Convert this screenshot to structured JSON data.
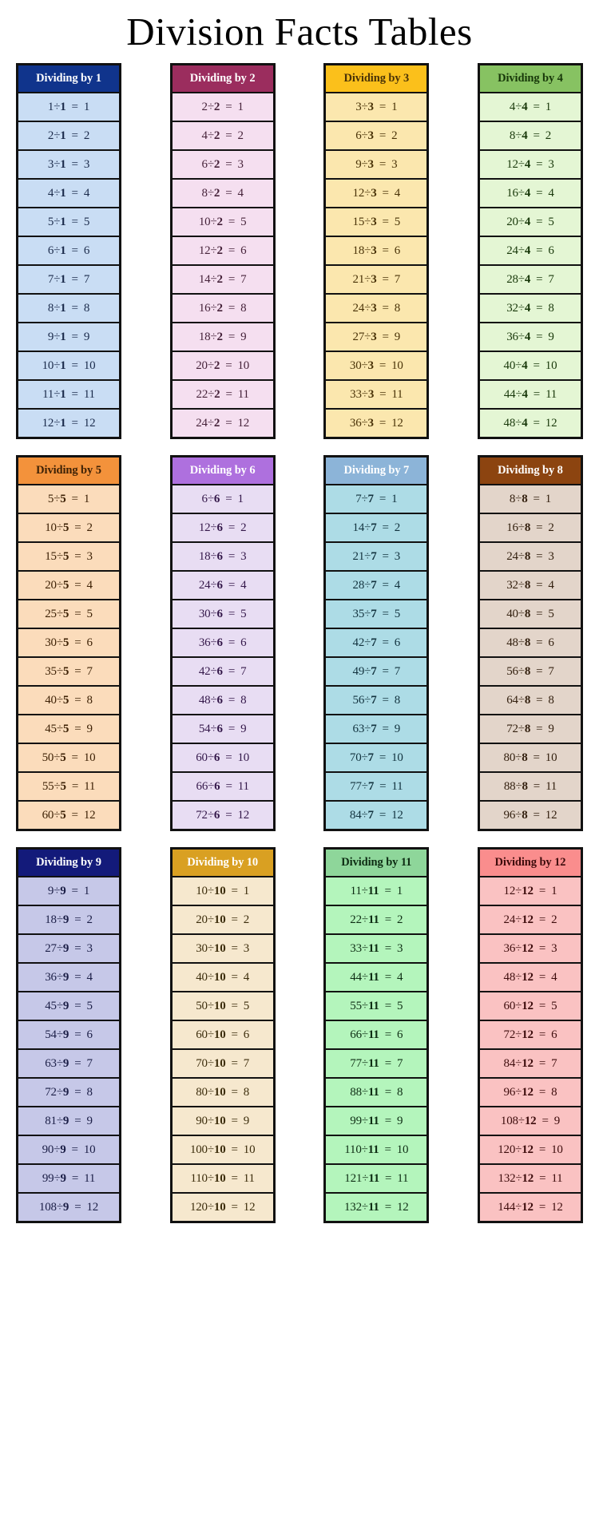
{
  "page": {
    "title": "Division Facts Tables"
  },
  "tables": [
    {
      "id": "dividing-by-1",
      "header": "Dividing by 1",
      "divisor": 1,
      "header_bg": "#10348C",
      "header_fg": "#FFFFFF",
      "cell_bg": "#C9DDF4",
      "cell_fg": "#1B2B4B",
      "rows": [
        {
          "dividend": 1,
          "divisor": 1,
          "quotient": 1
        },
        {
          "dividend": 2,
          "divisor": 1,
          "quotient": 2
        },
        {
          "dividend": 3,
          "divisor": 1,
          "quotient": 3
        },
        {
          "dividend": 4,
          "divisor": 1,
          "quotient": 4
        },
        {
          "dividend": 5,
          "divisor": 1,
          "quotient": 5
        },
        {
          "dividend": 6,
          "divisor": 1,
          "quotient": 6
        },
        {
          "dividend": 7,
          "divisor": 1,
          "quotient": 7
        },
        {
          "dividend": 8,
          "divisor": 1,
          "quotient": 8
        },
        {
          "dividend": 9,
          "divisor": 1,
          "quotient": 9
        },
        {
          "dividend": 10,
          "divisor": 1,
          "quotient": 10
        },
        {
          "dividend": 11,
          "divisor": 1,
          "quotient": 11
        },
        {
          "dividend": 12,
          "divisor": 1,
          "quotient": 12
        }
      ]
    },
    {
      "id": "dividing-by-2",
      "header": "Dividing by 2",
      "divisor": 2,
      "header_bg": "#9B2D5E",
      "header_fg": "#FFFFFF",
      "cell_bg": "#F5DFF0",
      "cell_fg": "#46233A",
      "rows": [
        {
          "dividend": 2,
          "divisor": 2,
          "quotient": 1
        },
        {
          "dividend": 4,
          "divisor": 2,
          "quotient": 2
        },
        {
          "dividend": 6,
          "divisor": 2,
          "quotient": 3
        },
        {
          "dividend": 8,
          "divisor": 2,
          "quotient": 4
        },
        {
          "dividend": 10,
          "divisor": 2,
          "quotient": 5
        },
        {
          "dividend": 12,
          "divisor": 2,
          "quotient": 6
        },
        {
          "dividend": 14,
          "divisor": 2,
          "quotient": 7
        },
        {
          "dividend": 16,
          "divisor": 2,
          "quotient": 8
        },
        {
          "dividend": 18,
          "divisor": 2,
          "quotient": 9
        },
        {
          "dividend": 20,
          "divisor": 2,
          "quotient": 10
        },
        {
          "dividend": 22,
          "divisor": 2,
          "quotient": 11
        },
        {
          "dividend": 24,
          "divisor": 2,
          "quotient": 12
        }
      ]
    },
    {
      "id": "dividing-by-3",
      "header": "Dividing by 3",
      "divisor": 3,
      "header_bg": "#FBC01B",
      "header_fg": "#4A3308",
      "cell_bg": "#FBE7AE",
      "cell_fg": "#4A3308",
      "rows": [
        {
          "dividend": 3,
          "divisor": 3,
          "quotient": 1
        },
        {
          "dividend": 6,
          "divisor": 3,
          "quotient": 2
        },
        {
          "dividend": 9,
          "divisor": 3,
          "quotient": 3
        },
        {
          "dividend": 12,
          "divisor": 3,
          "quotient": 4
        },
        {
          "dividend": 15,
          "divisor": 3,
          "quotient": 5
        },
        {
          "dividend": 18,
          "divisor": 3,
          "quotient": 6
        },
        {
          "dividend": 21,
          "divisor": 3,
          "quotient": 7
        },
        {
          "dividend": 24,
          "divisor": 3,
          "quotient": 8
        },
        {
          "dividend": 27,
          "divisor": 3,
          "quotient": 9
        },
        {
          "dividend": 30,
          "divisor": 3,
          "quotient": 10
        },
        {
          "dividend": 33,
          "divisor": 3,
          "quotient": 11
        },
        {
          "dividend": 36,
          "divisor": 3,
          "quotient": 12
        }
      ]
    },
    {
      "id": "dividing-by-4",
      "header": "Dividing by 4",
      "divisor": 4,
      "header_bg": "#87C262",
      "header_fg": "#18380A",
      "cell_bg": "#E4F6D4",
      "cell_fg": "#18380A",
      "rows": [
        {
          "dividend": 4,
          "divisor": 4,
          "quotient": 1
        },
        {
          "dividend": 8,
          "divisor": 4,
          "quotient": 2
        },
        {
          "dividend": 12,
          "divisor": 4,
          "quotient": 3
        },
        {
          "dividend": 16,
          "divisor": 4,
          "quotient": 4
        },
        {
          "dividend": 20,
          "divisor": 4,
          "quotient": 5
        },
        {
          "dividend": 24,
          "divisor": 4,
          "quotient": 6
        },
        {
          "dividend": 28,
          "divisor": 4,
          "quotient": 7
        },
        {
          "dividend": 32,
          "divisor": 4,
          "quotient": 8
        },
        {
          "dividend": 36,
          "divisor": 4,
          "quotient": 9
        },
        {
          "dividend": 40,
          "divisor": 4,
          "quotient": 10
        },
        {
          "dividend": 44,
          "divisor": 4,
          "quotient": 11
        },
        {
          "dividend": 48,
          "divisor": 4,
          "quotient": 12
        }
      ]
    },
    {
      "id": "dividing-by-5",
      "header": "Dividing by 5",
      "divisor": 5,
      "header_bg": "#F3923B",
      "header_fg": "#3E2206",
      "cell_bg": "#FBDCBB",
      "cell_fg": "#3E2206",
      "rows": [
        {
          "dividend": 5,
          "divisor": 5,
          "quotient": 1
        },
        {
          "dividend": 10,
          "divisor": 5,
          "quotient": 2
        },
        {
          "dividend": 15,
          "divisor": 5,
          "quotient": 3
        },
        {
          "dividend": 20,
          "divisor": 5,
          "quotient": 4
        },
        {
          "dividend": 25,
          "divisor": 5,
          "quotient": 5
        },
        {
          "dividend": 30,
          "divisor": 5,
          "quotient": 6
        },
        {
          "dividend": 35,
          "divisor": 5,
          "quotient": 7
        },
        {
          "dividend": 40,
          "divisor": 5,
          "quotient": 8
        },
        {
          "dividend": 45,
          "divisor": 5,
          "quotient": 9
        },
        {
          "dividend": 50,
          "divisor": 5,
          "quotient": 10
        },
        {
          "dividend": 55,
          "divisor": 5,
          "quotient": 11
        },
        {
          "dividend": 60,
          "divisor": 5,
          "quotient": 12
        }
      ]
    },
    {
      "id": "dividing-by-6",
      "header": "Dividing by 6",
      "divisor": 6,
      "header_bg": "#AE70DE",
      "header_fg": "#FFFFFF",
      "cell_bg": "#E8DDF3",
      "cell_fg": "#34184A",
      "rows": [
        {
          "dividend": 6,
          "divisor": 6,
          "quotient": 1
        },
        {
          "dividend": 12,
          "divisor": 6,
          "quotient": 2
        },
        {
          "dividend": 18,
          "divisor": 6,
          "quotient": 3
        },
        {
          "dividend": 24,
          "divisor": 6,
          "quotient": 4
        },
        {
          "dividend": 30,
          "divisor": 6,
          "quotient": 5
        },
        {
          "dividend": 36,
          "divisor": 6,
          "quotient": 6
        },
        {
          "dividend": 42,
          "divisor": 6,
          "quotient": 7
        },
        {
          "dividend": 48,
          "divisor": 6,
          "quotient": 8
        },
        {
          "dividend": 54,
          "divisor": 6,
          "quotient": 9
        },
        {
          "dividend": 60,
          "divisor": 6,
          "quotient": 10
        },
        {
          "dividend": 66,
          "divisor": 6,
          "quotient": 11
        },
        {
          "dividend": 72,
          "divisor": 6,
          "quotient": 12
        }
      ]
    },
    {
      "id": "dividing-by-7",
      "header": "Dividing by 7",
      "divisor": 7,
      "header_bg": "#8CB4D8",
      "header_fg": "#FFFFFF",
      "cell_bg": "#ADDCE6",
      "cell_fg": "#12323E",
      "rows": [
        {
          "dividend": 7,
          "divisor": 7,
          "quotient": 1
        },
        {
          "dividend": 14,
          "divisor": 7,
          "quotient": 2
        },
        {
          "dividend": 21,
          "divisor": 7,
          "quotient": 3
        },
        {
          "dividend": 28,
          "divisor": 7,
          "quotient": 4
        },
        {
          "dividend": 35,
          "divisor": 7,
          "quotient": 5
        },
        {
          "dividend": 42,
          "divisor": 7,
          "quotient": 6
        },
        {
          "dividend": 49,
          "divisor": 7,
          "quotient": 7
        },
        {
          "dividend": 56,
          "divisor": 7,
          "quotient": 8
        },
        {
          "dividend": 63,
          "divisor": 7,
          "quotient": 9
        },
        {
          "dividend": 70,
          "divisor": 7,
          "quotient": 10
        },
        {
          "dividend": 77,
          "divisor": 7,
          "quotient": 11
        },
        {
          "dividend": 84,
          "divisor": 7,
          "quotient": 12
        }
      ]
    },
    {
      "id": "dividing-by-8",
      "header": "Dividing by 8",
      "divisor": 8,
      "header_bg": "#8C4410",
      "header_fg": "#FFFFFF",
      "cell_bg": "#E3D5CA",
      "cell_fg": "#33200F",
      "rows": [
        {
          "dividend": 8,
          "divisor": 8,
          "quotient": 1
        },
        {
          "dividend": 16,
          "divisor": 8,
          "quotient": 2
        },
        {
          "dividend": 24,
          "divisor": 8,
          "quotient": 3
        },
        {
          "dividend": 32,
          "divisor": 8,
          "quotient": 4
        },
        {
          "dividend": 40,
          "divisor": 8,
          "quotient": 5
        },
        {
          "dividend": 48,
          "divisor": 8,
          "quotient": 6
        },
        {
          "dividend": 56,
          "divisor": 8,
          "quotient": 7
        },
        {
          "dividend": 64,
          "divisor": 8,
          "quotient": 8
        },
        {
          "dividend": 72,
          "divisor": 8,
          "quotient": 9
        },
        {
          "dividend": 80,
          "divisor": 8,
          "quotient": 10
        },
        {
          "dividend": 88,
          "divisor": 8,
          "quotient": 11
        },
        {
          "dividend": 96,
          "divisor": 8,
          "quotient": 12
        }
      ]
    },
    {
      "id": "dividing-by-9",
      "header": "Dividing by 9",
      "divisor": 9,
      "header_bg": "#131A7A",
      "header_fg": "#FFFFFF",
      "cell_bg": "#C6C8E8",
      "cell_fg": "#1B1E46",
      "rows": [
        {
          "dividend": 9,
          "divisor": 9,
          "quotient": 1
        },
        {
          "dividend": 18,
          "divisor": 9,
          "quotient": 2
        },
        {
          "dividend": 27,
          "divisor": 9,
          "quotient": 3
        },
        {
          "dividend": 36,
          "divisor": 9,
          "quotient": 4
        },
        {
          "dividend": 45,
          "divisor": 9,
          "quotient": 5
        },
        {
          "dividend": 54,
          "divisor": 9,
          "quotient": 6
        },
        {
          "dividend": 63,
          "divisor": 9,
          "quotient": 7
        },
        {
          "dividend": 72,
          "divisor": 9,
          "quotient": 8
        },
        {
          "dividend": 81,
          "divisor": 9,
          "quotient": 9
        },
        {
          "dividend": 90,
          "divisor": 9,
          "quotient": 10
        },
        {
          "dividend": 99,
          "divisor": 9,
          "quotient": 11
        },
        {
          "dividend": 108,
          "divisor": 9,
          "quotient": 12
        }
      ]
    },
    {
      "id": "dividing-by-10",
      "header": "Dividing by 10",
      "divisor": 10,
      "header_bg": "#D9A022",
      "header_fg": "#FFFFFF",
      "cell_bg": "#F6E8CE",
      "cell_fg": "#3C2D0C",
      "rows": [
        {
          "dividend": 10,
          "divisor": 10,
          "quotient": 1
        },
        {
          "dividend": 20,
          "divisor": 10,
          "quotient": 2
        },
        {
          "dividend": 30,
          "divisor": 10,
          "quotient": 3
        },
        {
          "dividend": 40,
          "divisor": 10,
          "quotient": 4
        },
        {
          "dividend": 50,
          "divisor": 10,
          "quotient": 5
        },
        {
          "dividend": 60,
          "divisor": 10,
          "quotient": 6
        },
        {
          "dividend": 70,
          "divisor": 10,
          "quotient": 7
        },
        {
          "dividend": 80,
          "divisor": 10,
          "quotient": 8
        },
        {
          "dividend": 90,
          "divisor": 10,
          "quotient": 9
        },
        {
          "dividend": 100,
          "divisor": 10,
          "quotient": 10
        },
        {
          "dividend": 110,
          "divisor": 10,
          "quotient": 11
        },
        {
          "dividend": 120,
          "divisor": 10,
          "quotient": 12
        }
      ]
    },
    {
      "id": "dividing-by-11",
      "header": "Dividing by 11",
      "divisor": 11,
      "header_bg": "#8ED69A",
      "header_fg": "#0E2D14",
      "cell_bg": "#B4F5BC",
      "cell_fg": "#0E2D14",
      "rows": [
        {
          "dividend": 11,
          "divisor": 11,
          "quotient": 1
        },
        {
          "dividend": 22,
          "divisor": 11,
          "quotient": 2
        },
        {
          "dividend": 33,
          "divisor": 11,
          "quotient": 3
        },
        {
          "dividend": 44,
          "divisor": 11,
          "quotient": 4
        },
        {
          "dividend": 55,
          "divisor": 11,
          "quotient": 5
        },
        {
          "dividend": 66,
          "divisor": 11,
          "quotient": 6
        },
        {
          "dividend": 77,
          "divisor": 11,
          "quotient": 7
        },
        {
          "dividend": 88,
          "divisor": 11,
          "quotient": 8
        },
        {
          "dividend": 99,
          "divisor": 11,
          "quotient": 9
        },
        {
          "dividend": 110,
          "divisor": 11,
          "quotient": 10
        },
        {
          "dividend": 121,
          "divisor": 11,
          "quotient": 11
        },
        {
          "dividend": 132,
          "divisor": 11,
          "quotient": 12
        }
      ]
    },
    {
      "id": "dividing-by-12",
      "header": "Dividing by 12",
      "divisor": 12,
      "header_bg": "#FA8D8D",
      "header_fg": "#3D0C0C",
      "cell_bg": "#FAC2C2",
      "cell_fg": "#3D0C0C",
      "rows": [
        {
          "dividend": 12,
          "divisor": 12,
          "quotient": 1
        },
        {
          "dividend": 24,
          "divisor": 12,
          "quotient": 2
        },
        {
          "dividend": 36,
          "divisor": 12,
          "quotient": 3
        },
        {
          "dividend": 48,
          "divisor": 12,
          "quotient": 4
        },
        {
          "dividend": 60,
          "divisor": 12,
          "quotient": 5
        },
        {
          "dividend": 72,
          "divisor": 12,
          "quotient": 6
        },
        {
          "dividend": 84,
          "divisor": 12,
          "quotient": 7
        },
        {
          "dividend": 96,
          "divisor": 12,
          "quotient": 8
        },
        {
          "dividend": 108,
          "divisor": 12,
          "quotient": 9
        },
        {
          "dividend": 120,
          "divisor": 12,
          "quotient": 10
        },
        {
          "dividend": 132,
          "divisor": 12,
          "quotient": 11
        },
        {
          "dividend": 144,
          "divisor": 12,
          "quotient": 12
        }
      ]
    }
  ],
  "symbols": {
    "division_sign": "÷",
    "equals_sign": "="
  },
  "layout": {
    "groups": [
      [
        0,
        1,
        2,
        3
      ],
      [
        4,
        5,
        6,
        7
      ],
      [
        8,
        9,
        10,
        11
      ]
    ],
    "border_color": "#111111",
    "page_bg": "#FFFFFF"
  }
}
